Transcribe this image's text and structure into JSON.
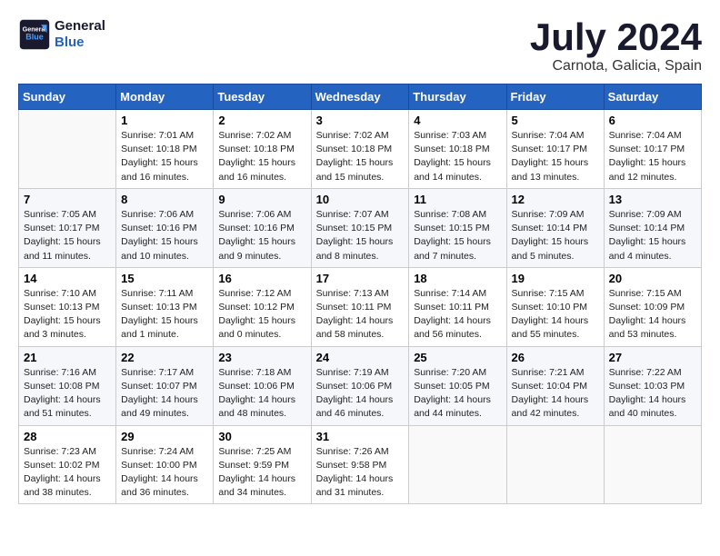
{
  "header": {
    "logo_line1": "General",
    "logo_line2": "Blue",
    "month": "July 2024",
    "location": "Carnota, Galicia, Spain"
  },
  "weekdays": [
    "Sunday",
    "Monday",
    "Tuesday",
    "Wednesday",
    "Thursday",
    "Friday",
    "Saturday"
  ],
  "weeks": [
    [
      {
        "day": "",
        "info": ""
      },
      {
        "day": "1",
        "info": "Sunrise: 7:01 AM\nSunset: 10:18 PM\nDaylight: 15 hours\nand 16 minutes."
      },
      {
        "day": "2",
        "info": "Sunrise: 7:02 AM\nSunset: 10:18 PM\nDaylight: 15 hours\nand 16 minutes."
      },
      {
        "day": "3",
        "info": "Sunrise: 7:02 AM\nSunset: 10:18 PM\nDaylight: 15 hours\nand 15 minutes."
      },
      {
        "day": "4",
        "info": "Sunrise: 7:03 AM\nSunset: 10:18 PM\nDaylight: 15 hours\nand 14 minutes."
      },
      {
        "day": "5",
        "info": "Sunrise: 7:04 AM\nSunset: 10:17 PM\nDaylight: 15 hours\nand 13 minutes."
      },
      {
        "day": "6",
        "info": "Sunrise: 7:04 AM\nSunset: 10:17 PM\nDaylight: 15 hours\nand 12 minutes."
      }
    ],
    [
      {
        "day": "7",
        "info": "Sunrise: 7:05 AM\nSunset: 10:17 PM\nDaylight: 15 hours\nand 11 minutes."
      },
      {
        "day": "8",
        "info": "Sunrise: 7:06 AM\nSunset: 10:16 PM\nDaylight: 15 hours\nand 10 minutes."
      },
      {
        "day": "9",
        "info": "Sunrise: 7:06 AM\nSunset: 10:16 PM\nDaylight: 15 hours\nand 9 minutes."
      },
      {
        "day": "10",
        "info": "Sunrise: 7:07 AM\nSunset: 10:15 PM\nDaylight: 15 hours\nand 8 minutes."
      },
      {
        "day": "11",
        "info": "Sunrise: 7:08 AM\nSunset: 10:15 PM\nDaylight: 15 hours\nand 7 minutes."
      },
      {
        "day": "12",
        "info": "Sunrise: 7:09 AM\nSunset: 10:14 PM\nDaylight: 15 hours\nand 5 minutes."
      },
      {
        "day": "13",
        "info": "Sunrise: 7:09 AM\nSunset: 10:14 PM\nDaylight: 15 hours\nand 4 minutes."
      }
    ],
    [
      {
        "day": "14",
        "info": "Sunrise: 7:10 AM\nSunset: 10:13 PM\nDaylight: 15 hours\nand 3 minutes."
      },
      {
        "day": "15",
        "info": "Sunrise: 7:11 AM\nSunset: 10:13 PM\nDaylight: 15 hours\nand 1 minute."
      },
      {
        "day": "16",
        "info": "Sunrise: 7:12 AM\nSunset: 10:12 PM\nDaylight: 15 hours\nand 0 minutes."
      },
      {
        "day": "17",
        "info": "Sunrise: 7:13 AM\nSunset: 10:11 PM\nDaylight: 14 hours\nand 58 minutes."
      },
      {
        "day": "18",
        "info": "Sunrise: 7:14 AM\nSunset: 10:11 PM\nDaylight: 14 hours\nand 56 minutes."
      },
      {
        "day": "19",
        "info": "Sunrise: 7:15 AM\nSunset: 10:10 PM\nDaylight: 14 hours\nand 55 minutes."
      },
      {
        "day": "20",
        "info": "Sunrise: 7:15 AM\nSunset: 10:09 PM\nDaylight: 14 hours\nand 53 minutes."
      }
    ],
    [
      {
        "day": "21",
        "info": "Sunrise: 7:16 AM\nSunset: 10:08 PM\nDaylight: 14 hours\nand 51 minutes."
      },
      {
        "day": "22",
        "info": "Sunrise: 7:17 AM\nSunset: 10:07 PM\nDaylight: 14 hours\nand 49 minutes."
      },
      {
        "day": "23",
        "info": "Sunrise: 7:18 AM\nSunset: 10:06 PM\nDaylight: 14 hours\nand 48 minutes."
      },
      {
        "day": "24",
        "info": "Sunrise: 7:19 AM\nSunset: 10:06 PM\nDaylight: 14 hours\nand 46 minutes."
      },
      {
        "day": "25",
        "info": "Sunrise: 7:20 AM\nSunset: 10:05 PM\nDaylight: 14 hours\nand 44 minutes."
      },
      {
        "day": "26",
        "info": "Sunrise: 7:21 AM\nSunset: 10:04 PM\nDaylight: 14 hours\nand 42 minutes."
      },
      {
        "day": "27",
        "info": "Sunrise: 7:22 AM\nSunset: 10:03 PM\nDaylight: 14 hours\nand 40 minutes."
      }
    ],
    [
      {
        "day": "28",
        "info": "Sunrise: 7:23 AM\nSunset: 10:02 PM\nDaylight: 14 hours\nand 38 minutes."
      },
      {
        "day": "29",
        "info": "Sunrise: 7:24 AM\nSunset: 10:00 PM\nDaylight: 14 hours\nand 36 minutes."
      },
      {
        "day": "30",
        "info": "Sunrise: 7:25 AM\nSunset: 9:59 PM\nDaylight: 14 hours\nand 34 minutes."
      },
      {
        "day": "31",
        "info": "Sunrise: 7:26 AM\nSunset: 9:58 PM\nDaylight: 14 hours\nand 31 minutes."
      },
      {
        "day": "",
        "info": ""
      },
      {
        "day": "",
        "info": ""
      },
      {
        "day": "",
        "info": ""
      }
    ]
  ]
}
